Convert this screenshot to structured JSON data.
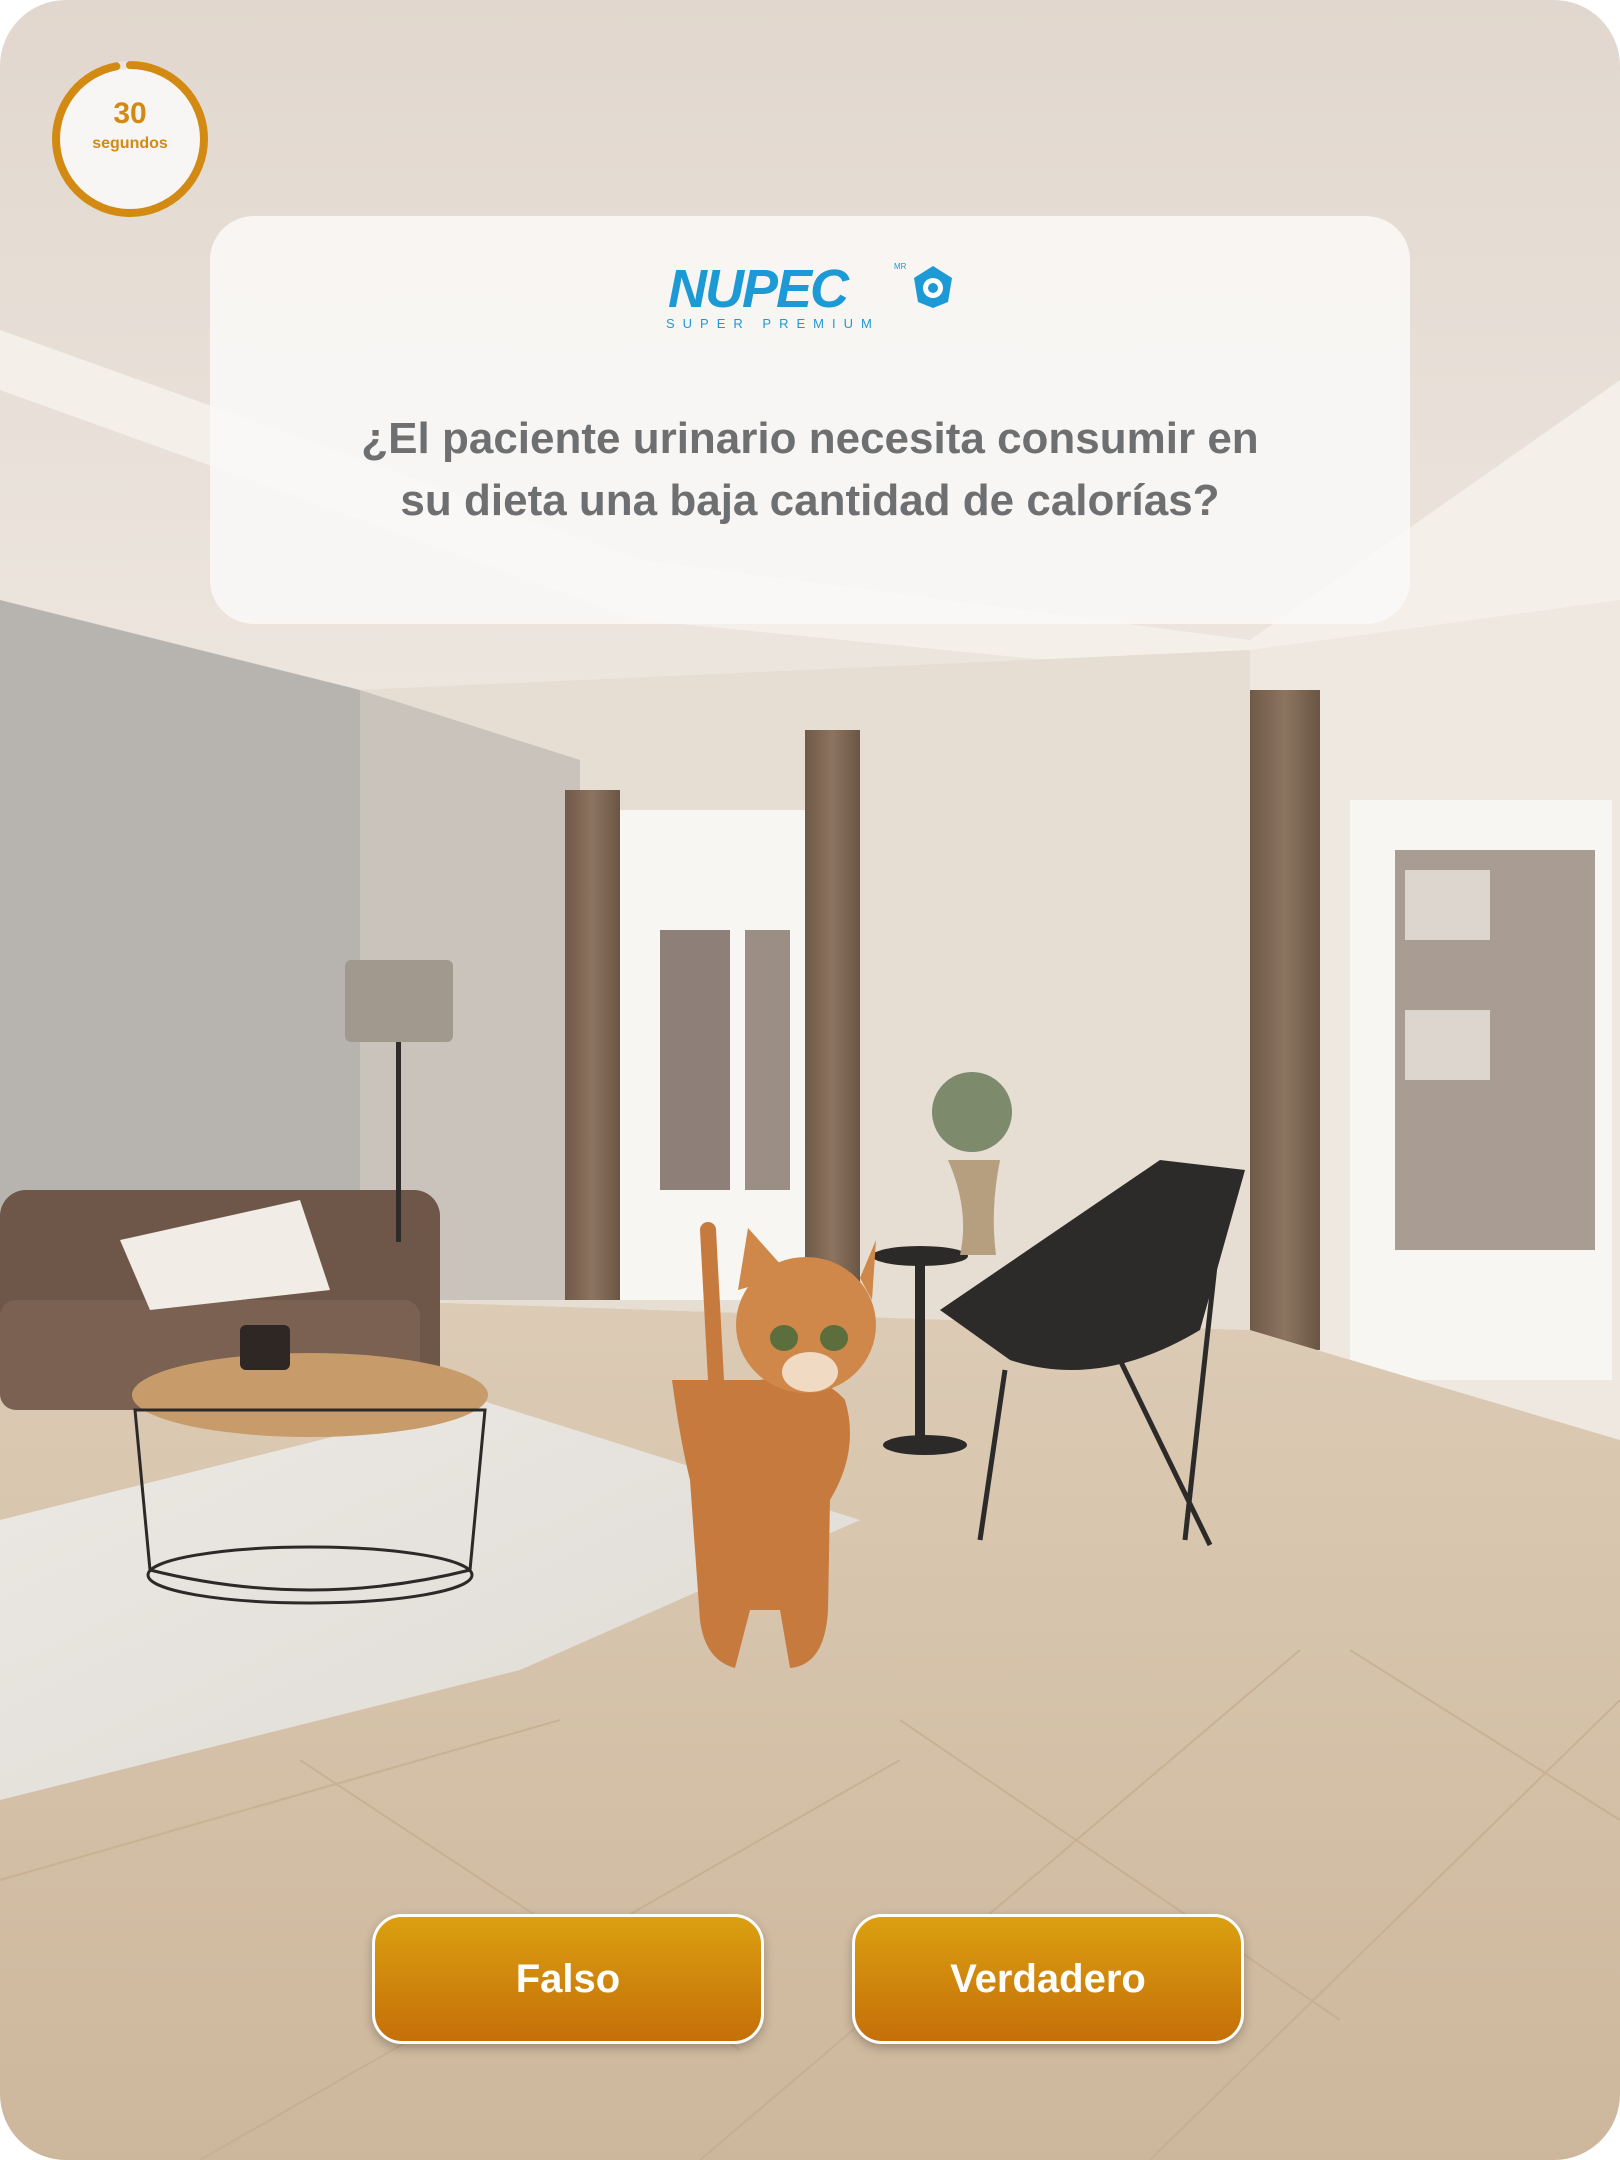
{
  "timer": {
    "value": "30",
    "unit": "segundos",
    "progress": 0.97,
    "color": "#d38a12"
  },
  "brand": {
    "name": "NUPEC",
    "tagline": "SUPER PREMIUM",
    "mark": "MR",
    "color": "#1b9ad6"
  },
  "question": {
    "line1": "¿El paciente urinario necesita consumir en",
    "line2": "su dieta una baja cantidad de calorías?"
  },
  "answers": {
    "false_label": "Falso",
    "true_label": "Verdadero"
  },
  "background": {
    "icon": "living-room-with-cat-photo"
  }
}
